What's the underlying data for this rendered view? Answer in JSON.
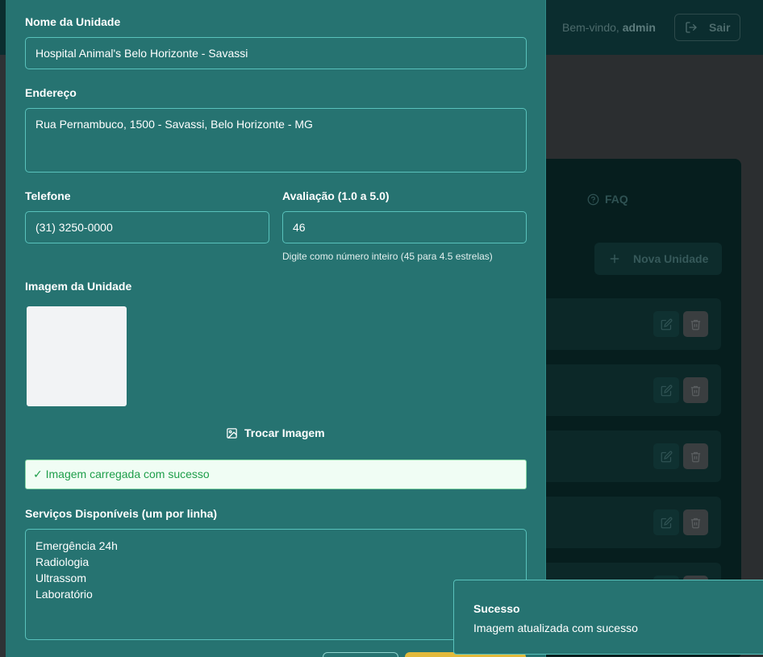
{
  "header": {
    "welcome_prefix": "Bem-vindo,",
    "username": "admin",
    "logout_label": "Sair"
  },
  "background": {
    "faq_tab_label": "FAQ",
    "new_unit_label": "Nova Unidade",
    "unit_rows": 5
  },
  "form": {
    "name": {
      "label": "Nome da Unidade",
      "value": "Hospital Animal's Belo Horizonte - Savassi"
    },
    "address": {
      "label": "Endereço",
      "value": "Rua Pernambuco, 1500 - Savassi, Belo Horizonte - MG"
    },
    "phone": {
      "label": "Telefone",
      "value": "(31) 3250-0000"
    },
    "rating": {
      "label": "Avaliação (1.0 a 5.0)",
      "value": "46",
      "hint": "Digite como número inteiro (45 para 4.5 estrelas)"
    },
    "image": {
      "label": "Imagem da Unidade",
      "swap_label": "Trocar Imagem",
      "success_text": "✓ Imagem carregada com sucesso"
    },
    "services": {
      "label": "Serviços Disponíveis (um por linha)",
      "value": "Emergência 24h\nRadiologia\nUltrassom\nLaboratório"
    }
  },
  "toast": {
    "title": "Sucesso",
    "message": "Imagem atualizada com sucesso"
  },
  "colors": {
    "modal_bg": "#267371",
    "field_border": "#59c2bc",
    "success_text": "#1e9e4a",
    "accent_yellow": "#e2b93b"
  }
}
